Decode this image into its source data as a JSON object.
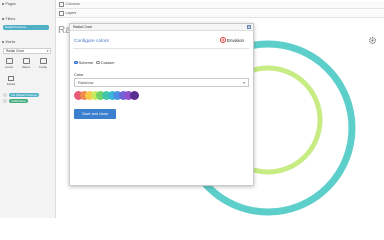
{
  "sidebar": {
    "pages_title": "Pages",
    "filters_title": "Filters",
    "filter_pill": "Radial Finetune",
    "marks_title": "Marks",
    "mark_type": "Radial Chart",
    "mark_buttons": [
      {
        "label": "Levels",
        "icon": "levels-icon"
      },
      {
        "label": "Values",
        "icon": "values-icon"
      },
      {
        "label": "Tooltip",
        "icon": "tooltip-icon"
      }
    ],
    "details_label": "Details",
    "fields": [
      {
        "label": "AG (Radial Finetune)",
        "color": "#4fb0c6"
      },
      {
        "label": "SUM(Sales)",
        "color": "#3daa7a"
      }
    ]
  },
  "shelves": {
    "columns_label": "Columns",
    "rows_label": "Layers"
  },
  "viz": {
    "title": "Radi"
  },
  "modal": {
    "title": "Radial Chart",
    "close_glyph": "×",
    "tab_label": "Configure colors",
    "brand_name": "Envision",
    "scheme_label": "Scheme",
    "custom_label": "Custom",
    "color_label": "Color",
    "color_value": "Rainbow",
    "save_label": "Save and close",
    "swatches": [
      "#e85d75",
      "#f08a4b",
      "#f7c948",
      "#c7e95e",
      "#6fd36a",
      "#41c7a8",
      "#38b8d6",
      "#4b8fe2",
      "#6e62d9",
      "#8f4fcb",
      "#5b2e91"
    ]
  },
  "colors": {
    "ring_outer": "#5dcfca",
    "ring_inner": "#c6ec83",
    "accent": "#3b80ce"
  }
}
